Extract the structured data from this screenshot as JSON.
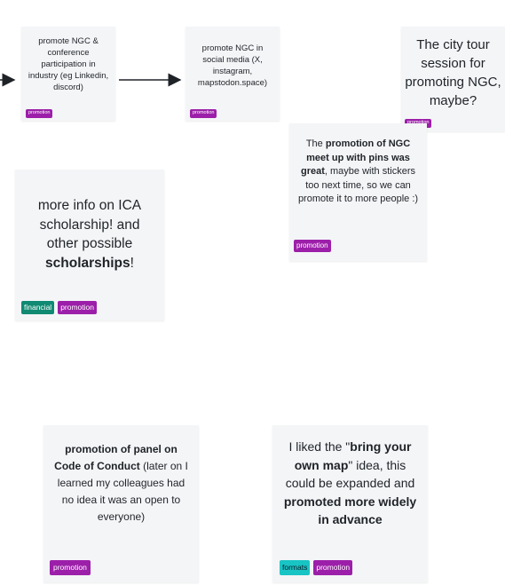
{
  "colors": {
    "note_bg": "#f4f5f7",
    "promotion_tag": "#9c1fa9",
    "financial_tag": "#108a72",
    "formats_tag": "#19c4c4",
    "arrow": "#1f2328"
  },
  "notes": {
    "ngc_conference": {
      "text": "promote NGC & conference participation in industry (eg Linkedin, discord)",
      "tag": "promotion"
    },
    "ngc_social": {
      "text": "promote NGC in social media (X, instagram, mapstodon.space)",
      "tag": "promotion"
    },
    "city_tour": {
      "text": "The city tour session for promoting NGC, maybe?",
      "tag": "promotion"
    },
    "meetup_pins": {
      "part1": "The ",
      "bold": "promotion of NGC meet up with pins was great",
      "part2": ", maybe with stickers too next time, so we can promote it to more people :)",
      "tag": "promotion"
    },
    "ica_scholarship": {
      "part1": "more info on ICA scholarship! and other possible ",
      "bold": "scholarships",
      "part2": "!",
      "tags": [
        "financial",
        "promotion"
      ]
    },
    "code_of_conduct": {
      "bold": "promotion of panel on Code of Conduct",
      "part2": " (later on I learned my colleagues had no idea it was an open to everyone)",
      "tag": "promotion"
    },
    "bring_map": {
      "part1": "I liked the \"",
      "bold1": "bring your own map",
      "part2": "\" idea, this could be expanded and ",
      "bold2": "promoted more widely in advance",
      "tags": [
        "formats",
        "promotion"
      ]
    }
  }
}
